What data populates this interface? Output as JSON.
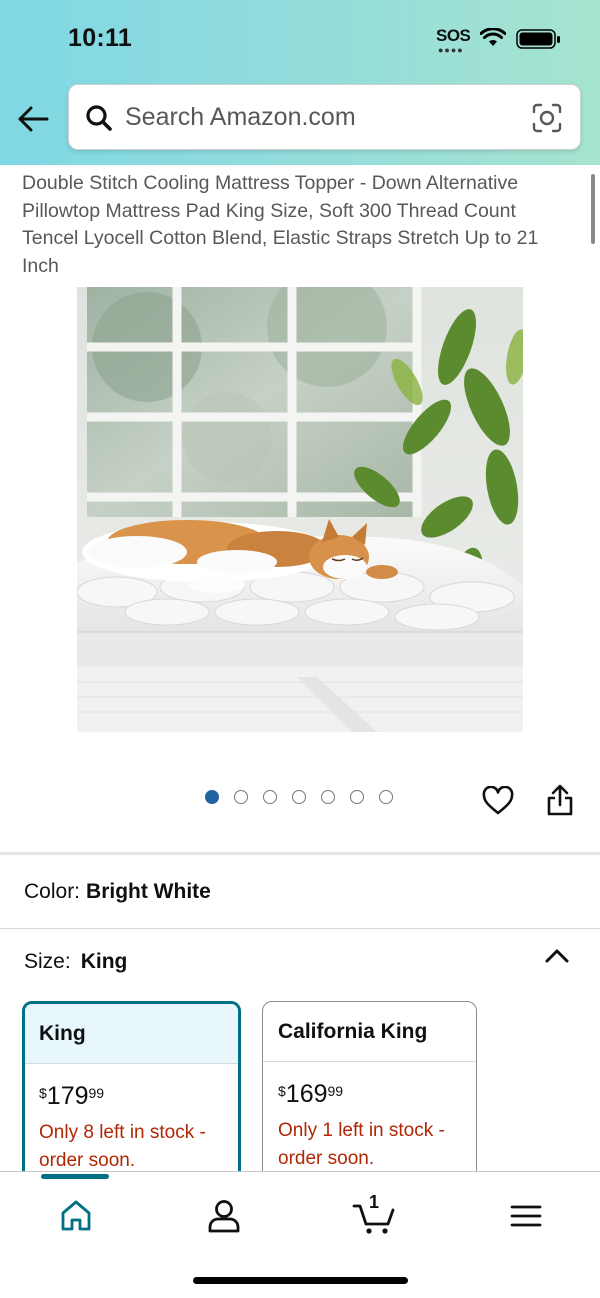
{
  "status_bar": {
    "time": "10:11",
    "sos": "SOS"
  },
  "search": {
    "placeholder": "Search Amazon.com"
  },
  "product": {
    "title": "Double Stitch Cooling Mattress Topper - Down Alternative Pillowtop Mattress Pad King Size, Soft 300 Thread Count Tencel Lyocell Cotton Blend, Elastic Straps Stretch Up to 21 Inch"
  },
  "carousel": {
    "total_images": 7,
    "current_index": 1
  },
  "color": {
    "label": "Color:",
    "value": "Bright White"
  },
  "size": {
    "label": "Size:",
    "value": "King",
    "options": [
      {
        "name": "King",
        "currency": "$",
        "price_whole": "179",
        "price_cents": "99",
        "stock": "Only 8 left in stock - order soon.",
        "selected": true
      },
      {
        "name": "California King",
        "currency": "$",
        "price_whole": "169",
        "price_cents": "99",
        "stock": "Only 1 left in stock - order soon.",
        "selected": false
      }
    ]
  },
  "bottom_nav": {
    "items": [
      "home-icon",
      "account-icon",
      "cart-icon",
      "menu-icon"
    ],
    "cart_count": "1",
    "active": "home"
  },
  "colors": {
    "accent": "#007185",
    "price_alert": "#b12704",
    "dot_active": "#2162a1"
  }
}
